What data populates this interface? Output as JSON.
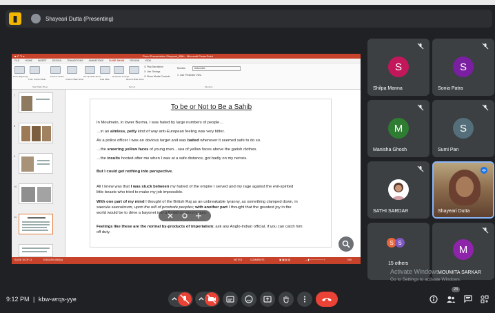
{
  "meeting": {
    "presenter_label": "Shayeari Dutta (Presenting)",
    "time": "9:12 PM",
    "code": "kbw-wrqs-yye",
    "separator": "|"
  },
  "powerpoint": {
    "window_title": "Prem Presentation Shayeari_8Bth - Microsoft PowerPoint",
    "menu": [
      "FILE",
      "HOME",
      "INSERT",
      "DESIGN",
      "TRANSITIONS",
      "ANIMATIONS",
      "SLIDE SHOW",
      "REVIEW",
      "VIEW"
    ],
    "active_menu": "SLIDE SHOW",
    "ribbon": {
      "buttons": [
        "From Beginning",
        "From Current Slide",
        "Present Online",
        "Custom Slide Show",
        "Set Up Slide Show",
        "Hide Slide",
        "Rehearse Timings",
        "Record Slide Show"
      ],
      "checks": [
        "Play Narrations",
        "Use Timings",
        "Show Media Controls",
        "Use Presenter View"
      ],
      "monitor_label": "Monitor:",
      "monitor_value": "Automatic",
      "groups": [
        "Start Slide Show",
        "Set Up",
        "Monitors"
      ]
    },
    "thumbnails": [
      "7",
      "8",
      "9",
      "10",
      "11"
    ],
    "selected_thumbnail": "10",
    "status": {
      "slide_info": "SLIDE 10 OF 11",
      "language": "ENGLISH (INDIA)",
      "notes": "NOTES",
      "comments": "COMMENTS",
      "zoom": "74%"
    }
  },
  "slide": {
    "title": "To be or Not to Be a Sahib",
    "lines": [
      {
        "pre": "In Moulmein, in lower Burma, I was hated by large numbers of people…",
        "bold": "",
        "post": ""
      },
      {
        "pre": "…in an ",
        "bold": "aimless, petty",
        "post": " kind of way anti-European feeling was very bitter."
      },
      {
        "pre": "As a police officer I was an obvious target and was ",
        "bold": "baited",
        "post": " whenever it seemed safe to do so."
      },
      {
        "pre": "…the ",
        "bold": "sneering yellow faces",
        "post": " of young men…sea of yellow faces above the garish clothes."
      },
      {
        "pre": "…the ",
        "bold": "insults",
        "post": " hooted after me when I was at a safe distance, got badly on my nerves."
      },
      {
        "pre": "",
        "bold": "But I could get nothing into perspective.",
        "post": ""
      },
      {
        "pre": "All I knew was that ",
        "bold": "I was stuck between",
        "post": " my hatred of the empire I served and my rage against the evil-spirited"
      },
      {
        "pre": "little beasts who tried to make my job impossible.",
        "bold": "",
        "post": ""
      },
      {
        "pre": "",
        "bold": "With one part of my mind",
        "post": " I thought of the British Raj as an unbreakable tyranny, as something clamped down, in"
      },
      {
        "pre": "saecula saeculorum, upon the will of prostrate peoples; ",
        "bold": "with another part",
        "post": " I thought that the greatest joy in the"
      },
      {
        "pre": "world would be to drive a bayonet into a Buddhist priest's guts.",
        "bold": "",
        "post": ""
      },
      {
        "pre": "",
        "bold": "Feelings like these are the normal by-products of imperialism",
        "post": "; ask any Anglo-Indian official, if you can catch him"
      },
      {
        "pre": "off duty.",
        "bold": "",
        "post": ""
      }
    ]
  },
  "participants": [
    {
      "name": "Shilpa Manna",
      "initial": "S",
      "color": "#c2185b",
      "muted": true
    },
    {
      "name": "Sonia Patra",
      "initial": "S",
      "color": "#7b1fa2",
      "muted": true
    },
    {
      "name": "Manisha Ghosh",
      "initial": "M",
      "color": "#2e7d32",
      "muted": true
    },
    {
      "name": "Sumi Pan",
      "initial": "S",
      "color": "#546e7a",
      "muted": true
    },
    {
      "name": "SATHI SARDAR",
      "initial": "",
      "color": "#ffffff",
      "muted": true
    },
    {
      "name": "Shayeari Dutta",
      "initial": "",
      "color": "#8d6d4d",
      "muted": false
    },
    {
      "name": "15 others",
      "initial": "S",
      "color": "#e8663b",
      "muted": false
    },
    {
      "name": "MOUMITA SARKAR",
      "initial": "M",
      "color": "#8e24aa",
      "muted": true
    }
  ],
  "others_avatars": [
    {
      "initial": "S",
      "color": "#e8663b"
    },
    {
      "initial": "S",
      "color": "#7e57c2"
    }
  ],
  "watermark": {
    "line1": "Activate Windows",
    "line2": "Go to Settings to activate Windows."
  },
  "controls": {
    "participant_count": "23"
  },
  "colors": {
    "background": "#202124",
    "tile": "#3c4043",
    "red": "#ea4335",
    "accent_yellow": "#f2b600",
    "ppt_red": "#c7422a"
  }
}
